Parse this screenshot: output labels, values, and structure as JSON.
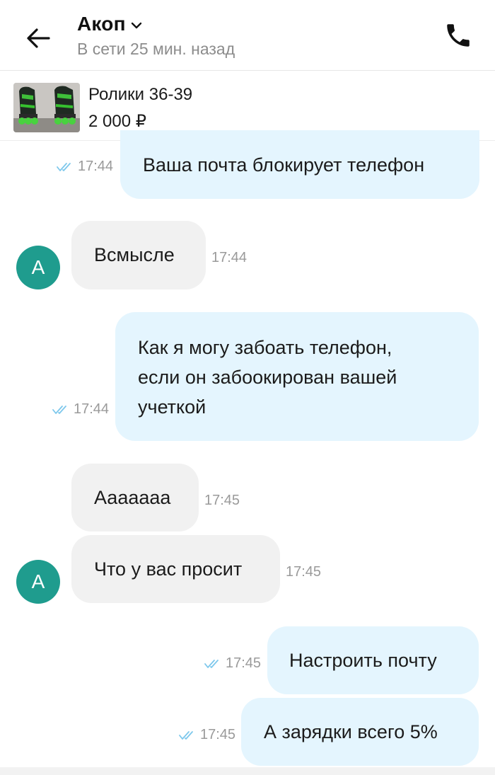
{
  "header": {
    "name": "Акоп",
    "status": "В сети 25 мин. назад",
    "icons": {
      "back": "back-arrow-icon",
      "call": "phone-icon",
      "dropdown": "chevron-down-icon"
    }
  },
  "product": {
    "title": "Ролики 36-39",
    "price": "2 000 ₽"
  },
  "messages": [
    {
      "side": "out",
      "text": "Ваша почта блокирует телефон",
      "time": "17:44",
      "read": true
    },
    {
      "side": "in",
      "text": "Всмысле",
      "time": "17:44",
      "avatar": "А"
    },
    {
      "side": "out",
      "text_lines": [
        "Как я могу забоать телефон,",
        "если он забоокирован вашей",
        "учеткой"
      ],
      "time": "17:44",
      "read": true
    },
    {
      "side": "in",
      "text": "Ааааааа",
      "time": "17:45"
    },
    {
      "side": "in",
      "text": "Что у вас просит",
      "time": "17:45",
      "avatar": "А"
    },
    {
      "side": "out",
      "text": "Настроить почту",
      "time": "17:45",
      "read": true
    },
    {
      "side": "out",
      "text": "А зарядки всего 5%",
      "time": "17:45",
      "read": true
    }
  ],
  "colors": {
    "outgoing_bubble": "#e4f5fe",
    "incoming_bubble": "#f1f1f1",
    "avatar": "#1f9c8e",
    "read_checks": "#7ec8ec"
  }
}
